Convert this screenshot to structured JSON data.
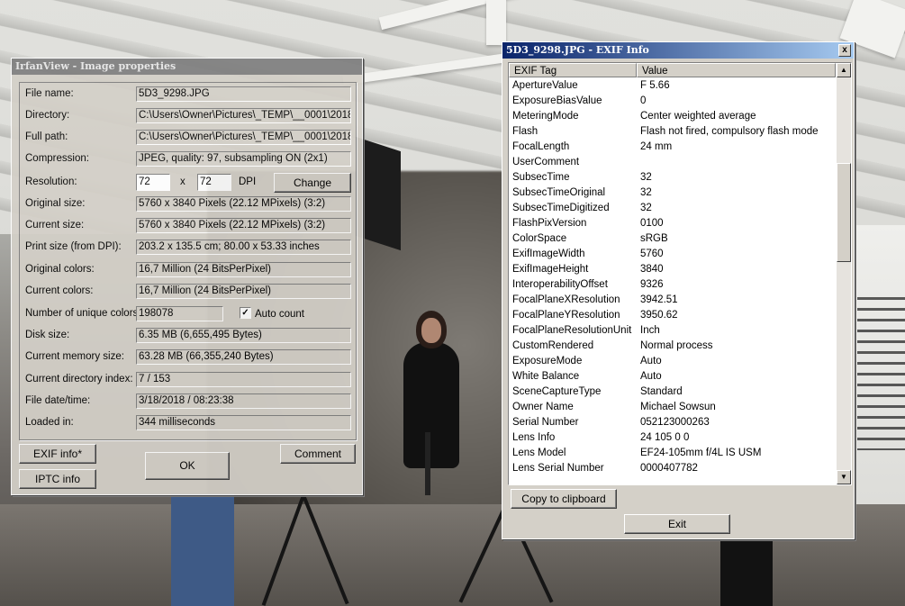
{
  "props": {
    "title": "IrfanView - Image properties",
    "rows": [
      {
        "label": "File name:",
        "value": "5D3_9298.JPG"
      },
      {
        "label": "Directory:",
        "value": "C:\\Users\\Owner\\Pictures\\_TEMP\\__0001\\2018"
      },
      {
        "label": "Full path:",
        "value": "C:\\Users\\Owner\\Pictures\\_TEMP\\__0001\\2018"
      },
      {
        "label": "Compression:",
        "value": "JPEG, quality: 97, subsampling ON (2x1)"
      },
      {
        "label": "Original size:",
        "value": "5760 x 3840  Pixels (22.12 MPixels) (3:2)"
      },
      {
        "label": "Current size:",
        "value": "5760 x 3840  Pixels (22.12 MPixels) (3:2)"
      },
      {
        "label": "Print size (from DPI):",
        "value": "203.2 x 135.5 cm; 80.00 x 53.33 inches"
      },
      {
        "label": "Original colors:",
        "value": "16,7 Million   (24 BitsPerPixel)"
      },
      {
        "label": "Current colors:",
        "value": "16,7 Million   (24 BitsPerPixel)"
      },
      {
        "label": "Disk size:",
        "value": "6.35 MB (6,655,495 Bytes)"
      },
      {
        "label": "Current memory size:",
        "value": "63.28  MB (66,355,240 Bytes)"
      },
      {
        "label": "Current directory index:",
        "value": "7  /  153"
      },
      {
        "label": "File date/time:",
        "value": "3/18/2018 / 08:23:38"
      },
      {
        "label": "Loaded in:",
        "value": "344 milliseconds"
      }
    ],
    "resolution": {
      "label": "Resolution:",
      "x": "72",
      "sep": "x",
      "y": "72",
      "unit": "DPI",
      "change_label": "Change"
    },
    "unique": {
      "label": "Number of unique colors:",
      "value": "198078",
      "checkbox_label": "Auto count",
      "checked": true
    },
    "buttons": {
      "exif": "EXIF info*",
      "iptc": "IPTC info",
      "ok": "OK",
      "comment": "Comment"
    }
  },
  "exif": {
    "title": "5D3_9298.JPG - EXIF Info",
    "columns": [
      "EXIF Tag",
      "Value"
    ],
    "rows": [
      {
        "tag": "ApertureValue",
        "value": "F 5.66"
      },
      {
        "tag": "ExposureBiasValue",
        "value": "0"
      },
      {
        "tag": "MeteringMode",
        "value": "Center weighted average"
      },
      {
        "tag": "Flash",
        "value": "Flash not fired, compulsory flash mode"
      },
      {
        "tag": "FocalLength",
        "value": "24 mm"
      },
      {
        "tag": "UserComment",
        "value": ""
      },
      {
        "tag": "SubsecTime",
        "value": "32"
      },
      {
        "tag": "SubsecTimeOriginal",
        "value": "32"
      },
      {
        "tag": "SubsecTimeDigitized",
        "value": "32"
      },
      {
        "tag": "FlashPixVersion",
        "value": "0100"
      },
      {
        "tag": "ColorSpace",
        "value": "sRGB"
      },
      {
        "tag": "ExifImageWidth",
        "value": "5760"
      },
      {
        "tag": "ExifImageHeight",
        "value": "3840"
      },
      {
        "tag": "InteroperabilityOffset",
        "value": "9326"
      },
      {
        "tag": "FocalPlaneXResolution",
        "value": "3942.51"
      },
      {
        "tag": "FocalPlaneYResolution",
        "value": "3950.62"
      },
      {
        "tag": "FocalPlaneResolutionUnit",
        "value": "Inch"
      },
      {
        "tag": "CustomRendered",
        "value": "Normal process"
      },
      {
        "tag": "ExposureMode",
        "value": "Auto"
      },
      {
        "tag": "White Balance",
        "value": "Auto"
      },
      {
        "tag": "SceneCaptureType",
        "value": "Standard"
      },
      {
        "tag": "Owner Name",
        "value": "Michael Sowsun"
      },
      {
        "tag": "Serial Number",
        "value": "052123000263"
      },
      {
        "tag": "Lens Info",
        "value": "24  105  0  0"
      },
      {
        "tag": "Lens Model",
        "value": "EF24-105mm f/4L IS USM"
      },
      {
        "tag": "Lens Serial Number",
        "value": "0000407782"
      }
    ],
    "buttons": {
      "copy": "Copy to clipboard",
      "exit": "Exit",
      "close_glyph": "x"
    },
    "scroll_position": 0.45
  },
  "colors": {
    "active_title_start": "#0a246a",
    "active_title_end": "#a6caf0",
    "inactive_title": "#808080",
    "face": "#d4d0c8"
  }
}
